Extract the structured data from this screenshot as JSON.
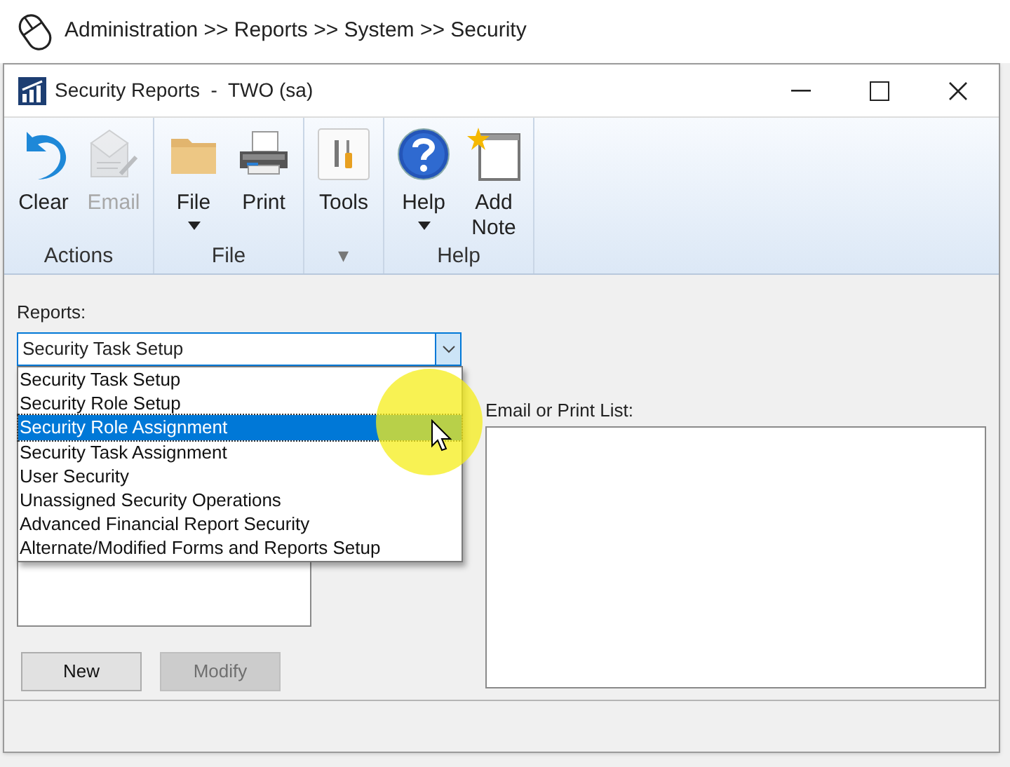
{
  "breadcrumb": "Administration >> Reports >> System >> Security",
  "window": {
    "title": "Security Reports  -  TWO (sa)"
  },
  "ribbon": {
    "groups": [
      {
        "label": "Actions",
        "buttons": [
          {
            "label": "Clear",
            "kind": "clear",
            "disabled": false,
            "dropdown": false
          },
          {
            "label": "Email",
            "kind": "email",
            "disabled": true,
            "dropdown": false
          }
        ]
      },
      {
        "label": "File",
        "buttons": [
          {
            "label": "File",
            "kind": "folder",
            "disabled": false,
            "dropdown": true
          },
          {
            "label": "Print",
            "kind": "print",
            "disabled": false,
            "dropdown": false
          }
        ]
      },
      {
        "label": "▾",
        "buttons": [
          {
            "label": "Tools",
            "kind": "tools",
            "disabled": false,
            "dropdown": false
          }
        ]
      },
      {
        "label": "Help",
        "buttons": [
          {
            "label": "Help",
            "kind": "help",
            "disabled": false,
            "dropdown": true
          },
          {
            "label": "Add Note",
            "kind": "note",
            "disabled": false,
            "dropdown": false
          }
        ]
      }
    ]
  },
  "reports": {
    "label": "Reports:",
    "value": "Security Task Setup",
    "expanded": true,
    "options": [
      {
        "label": "Security Task Setup",
        "highlighted": false
      },
      {
        "label": "Security Role Setup",
        "highlighted": false
      },
      {
        "label": "Security Role Assignment",
        "highlighted": true
      },
      {
        "label": "Security Task Assignment",
        "highlighted": false
      },
      {
        "label": "User Security",
        "highlighted": false
      },
      {
        "label": "Unassigned Security Operations",
        "highlighted": false
      },
      {
        "label": "Advanced Financial Report Security",
        "highlighted": false
      },
      {
        "label": "Alternate/Modified Forms and Reports Setup",
        "highlighted": false
      }
    ]
  },
  "email_list": {
    "label": "Email or Print List:"
  },
  "buttons": [
    {
      "label": "New",
      "disabled": false
    },
    {
      "label": "Modify",
      "disabled": true
    }
  ]
}
